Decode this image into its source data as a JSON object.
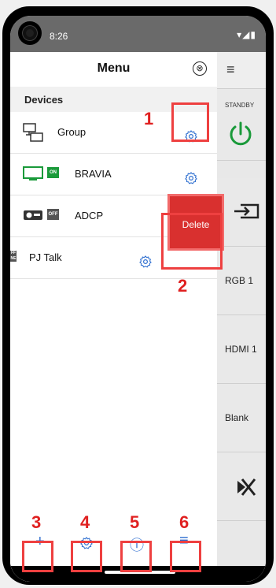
{
  "status": {
    "time": "8:26",
    "icons": "▾◢▮"
  },
  "drawer": {
    "title": "Menu",
    "close_icon": "⊗"
  },
  "section": {
    "label": "Devices"
  },
  "devices": [
    {
      "name": "Group",
      "badge": ""
    },
    {
      "name": "BRAVIA",
      "badge": "ON"
    },
    {
      "name": "ADCP",
      "badge": "OFF"
    },
    {
      "name": "PJ Talk",
      "badge": "FF NE"
    }
  ],
  "delete_label": "Delete",
  "annotations": {
    "n1": "1",
    "n2": "2",
    "n3": "3",
    "n4": "4",
    "n5": "5",
    "n6": "6"
  },
  "bottom": {
    "add": "+",
    "info": "ⓘ",
    "list": "≡"
  },
  "right_panel": {
    "standby": "STANDBY",
    "rgb": "RGB 1",
    "hdmi": "HDMI 1",
    "blank": "Blank"
  },
  "colors": {
    "accent": "#2f6fd0",
    "delete": "#d9302f",
    "highlight": "#ee4040",
    "on_badge": "#1a9a3a"
  }
}
